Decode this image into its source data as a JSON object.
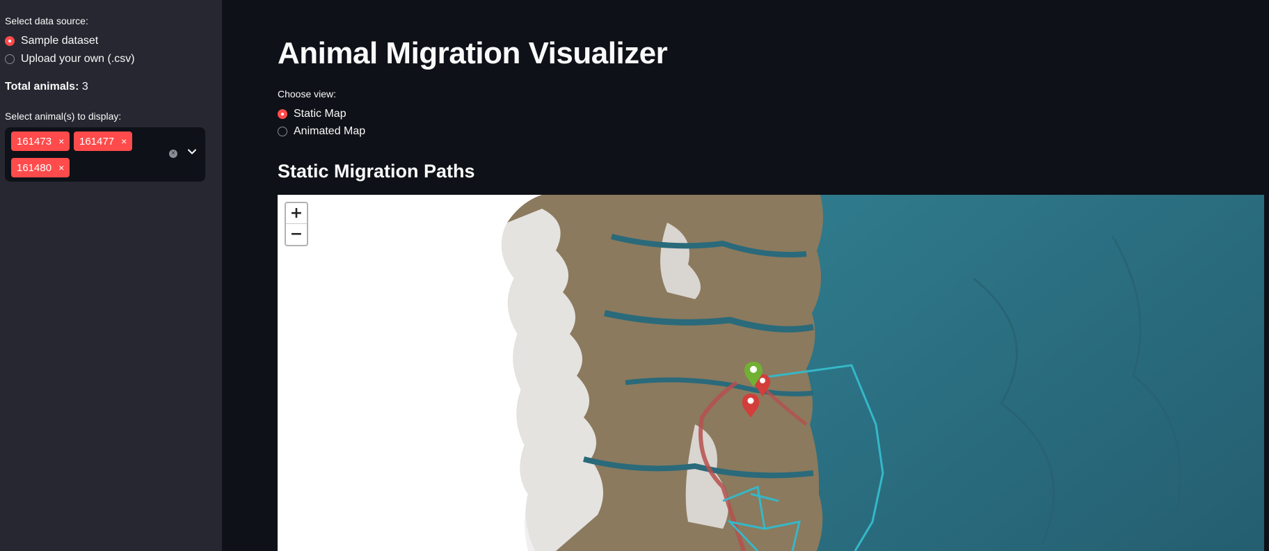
{
  "sidebar": {
    "data_source_label": "Select data source:",
    "options": [
      {
        "label": "Sample dataset",
        "selected": true
      },
      {
        "label": "Upload your own (.csv)",
        "selected": false
      }
    ],
    "total_label": "Total animals:",
    "total_value": "3",
    "select_label": "Select animal(s) to display:",
    "selected_animals": [
      "161473",
      "161477",
      "161480"
    ],
    "tag_remove": "×",
    "clear_icon": "clear-all-icon",
    "dropdown_icon": "chevron-down-icon"
  },
  "main": {
    "title": "Animal Migration Visualizer",
    "view_label": "Choose view:",
    "view_options": [
      {
        "label": "Static Map",
        "selected": true
      },
      {
        "label": "Animated Map",
        "selected": false
      }
    ],
    "section_title": "Static Migration Paths"
  },
  "map": {
    "zoom_in": "+",
    "zoom_out": "−",
    "colors": {
      "ocean": "#2c6f82",
      "land": "#7a6a52",
      "snow": "#f2f2f2",
      "path_cyan": "#35b8c8",
      "path_red": "#b5504e",
      "marker_red": "#d33d3a",
      "marker_green": "#71b033"
    }
  }
}
